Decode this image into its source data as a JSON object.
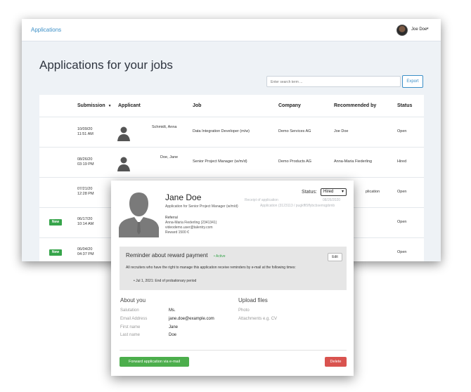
{
  "topbar": {
    "applications_link": "Applications",
    "user_name": "Joe Doe",
    "caret": "▾"
  },
  "page": {
    "title": "Applications for your jobs",
    "search_placeholder": "Enter search term ...",
    "export_label": "Export"
  },
  "table": {
    "headers": {
      "submission": "Submission",
      "sort_icon": "▼",
      "applicant": "Applicant",
      "job": "Job",
      "company": "Company",
      "recommended_by": "Recommended by",
      "status": "Status"
    },
    "rows": [
      {
        "badge": "",
        "date": "10/09/20",
        "time": "11:51 AM",
        "applicant": "Schmidt, Anna",
        "job": "Data Integration Developer (m/w)",
        "company": "Demo Services AG",
        "recommended": "Joe Doe",
        "status": "Open"
      },
      {
        "badge": "",
        "date": "08/26/20",
        "time": "03:19 PM",
        "applicant": "Doe, Jane",
        "job": "Senior Project Manager (w/m/d)",
        "company": "Demo Products AG",
        "recommended": "Anna-Maria Fiederling",
        "status": "Hired"
      },
      {
        "badge": "",
        "date": "07/21/20",
        "time": "12:28 PM",
        "applicant": "",
        "job": "",
        "company": "",
        "recommended": "plication",
        "status": "Open"
      },
      {
        "badge": "New",
        "date": "06/17/20",
        "time": "10:14 AM",
        "applicant": "",
        "job": "",
        "company": "",
        "recommended": "",
        "status": "Open"
      },
      {
        "badge": "New",
        "date": "06/04/20",
        "time": "04:37 PM",
        "applicant": "",
        "job": "",
        "company": "",
        "recommended": "",
        "status": "Open"
      }
    ]
  },
  "detail": {
    "name": "Jane Doe",
    "applied_for": "Application for Senior Project Manager (w/m/d)",
    "referral_label": "Referral",
    "referral_lines": [
      "Anna-Maria Fiederling (2341341)",
      "videodemo.user@talentry.com",
      "Reward 1500 €"
    ],
    "receipt_label": "Receipt of application",
    "receipt_date": "08/26/2020",
    "application_id": "Application (3123113 / pugkffi5ffybcbsemqpbmb",
    "status_label": "Status:",
    "status_value": "Hired",
    "status_caret": "▾",
    "reminder": {
      "title": "Reminder about reward payment",
      "active": "• Active",
      "edit": "Edit",
      "description": "All recruiters who have the right to manage this application receive reminders by e-mail at the following times:",
      "items": [
        "•   Jul 1, 2021: End of probationary period"
      ]
    },
    "about": {
      "title": "About you",
      "fields": [
        {
          "label": "Salutation",
          "value": "Ms."
        },
        {
          "label": "Email Address",
          "value": "jane.doe@example.com"
        },
        {
          "label": "First name",
          "value": "Jane"
        },
        {
          "label": "Last name",
          "value": "Doe"
        }
      ]
    },
    "upload": {
      "title": "Upload files",
      "fields": [
        "Photo",
        "Attachments e.g. CV"
      ]
    },
    "forward_button": "Forward application via e-mail",
    "delete_button": "Delete"
  },
  "colors": {
    "link": "#3b8fc7",
    "success": "#36a44a",
    "danger": "#d9534f",
    "panel_gray": "#e6e6e6"
  },
  "icons": [
    "user-avatar-icon",
    "person-silhouette-icon",
    "sort-down-icon",
    "chevron-down-icon"
  ]
}
